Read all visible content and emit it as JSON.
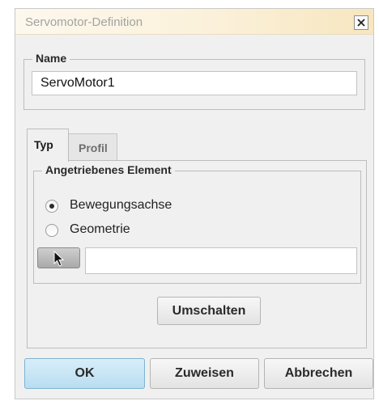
{
  "window": {
    "title": "Servomotor-Definition",
    "close_icon": "close-icon"
  },
  "name_group": {
    "legend": "Name",
    "value": "ServoMotor1"
  },
  "tabs": [
    {
      "label": "Typ",
      "active": true
    },
    {
      "label": "Profil",
      "active": false
    }
  ],
  "driven_element": {
    "legend": "Angetriebenes Element",
    "options": [
      {
        "label": "Bewegungsachse",
        "selected": true
      },
      {
        "label": "Geometrie",
        "selected": false
      }
    ],
    "pick_icon": "arrow-cursor-icon",
    "pick_value": ""
  },
  "buttons": {
    "toggle": "Umschalten",
    "ok": "OK",
    "assign": "Zuweisen",
    "cancel": "Abbrechen"
  },
  "colors": {
    "title_gradient_end": "#f7e6bf",
    "ok_button": "#b9ddf1",
    "dialog_bg": "#f0f0f0"
  }
}
